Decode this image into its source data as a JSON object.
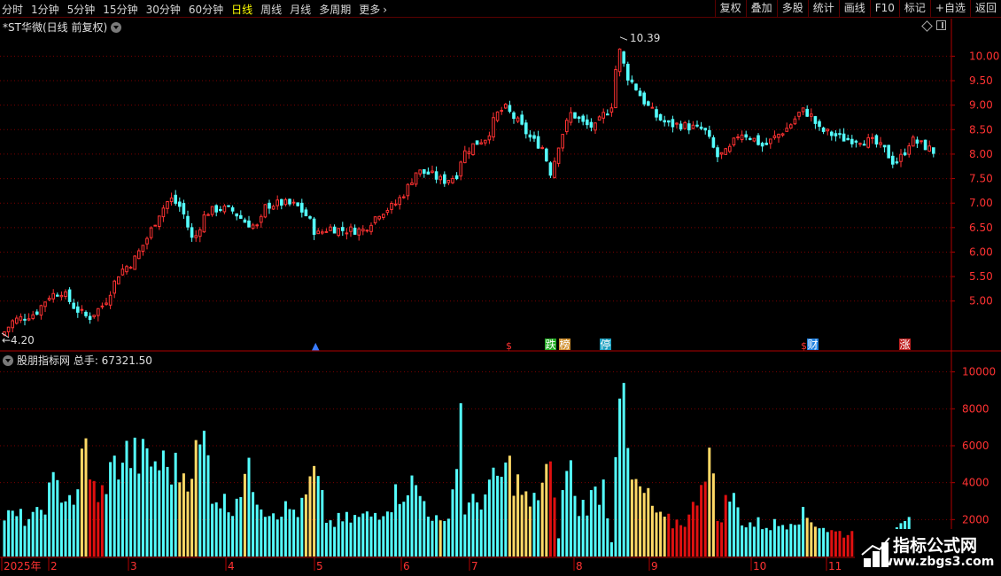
{
  "toolbar": {
    "periods": [
      {
        "label": "分时",
        "active": false
      },
      {
        "label": "1分钟",
        "active": false
      },
      {
        "label": "5分钟",
        "active": false
      },
      {
        "label": "15分钟",
        "active": false
      },
      {
        "label": "30分钟",
        "active": false
      },
      {
        "label": "60分钟",
        "active": false
      },
      {
        "label": "日线",
        "active": true
      },
      {
        "label": "周线",
        "active": false
      },
      {
        "label": "月线",
        "active": false
      },
      {
        "label": "多周期",
        "active": false
      }
    ],
    "more_label": "更多",
    "right_buttons": [
      "复权",
      "叠加",
      "多股",
      "统计",
      "画线",
      "F10",
      "标记",
      "+自选",
      "返回"
    ]
  },
  "main_chart": {
    "title": "*ST华微(日线 前复权)",
    "high_label": "10.39",
    "low_label": "4.20",
    "y_ticks": [
      "10.00",
      "9.50",
      "9.00",
      "8.50",
      "8.00",
      "7.50",
      "7.00",
      "6.50",
      "6.00",
      "5.50",
      "5.00"
    ],
    "markers": [
      {
        "label": "跌",
        "color": "#22aa22"
      },
      {
        "label": "榜",
        "color": "#d09030"
      },
      {
        "label": "停",
        "color": "#20a0c0"
      },
      {
        "label": "财",
        "color": "#2080e0"
      },
      {
        "label": "涨",
        "color": "#c02020"
      }
    ]
  },
  "volume_chart": {
    "title": "股朋指标网 总手: 67321.50",
    "y_ticks": [
      "10000",
      "8000",
      "6000",
      "4000",
      "2000"
    ]
  },
  "date_axis": {
    "labels": [
      "2025年",
      "2",
      "3",
      "4",
      "5",
      "6",
      "7",
      "8",
      "9",
      "10",
      "11"
    ]
  },
  "watermark": {
    "title": "指标公式网",
    "url": "www.zbgs3.com"
  },
  "colors": {
    "up": "#ff3232",
    "down": "#54ffff",
    "grid": "#7a0000",
    "axis": "#b00000",
    "vol_yellow": "#ffd966",
    "vol_red": "#e01010",
    "active_period": "#ffff00"
  },
  "chart_data": {
    "type": "candlestick",
    "title": "*ST华微(日线 前复权)",
    "y_range": [
      4.2,
      10.39
    ],
    "volume_range": [
      0,
      10500
    ],
    "price_path_anchors": [
      {
        "month": "2025-01",
        "close": 4.7
      },
      {
        "month": "2025-02",
        "close": 4.9
      },
      {
        "month": "2025-03",
        "close": 6.5
      },
      {
        "month": "2025-04",
        "close": 6.8
      },
      {
        "month": "2025-05",
        "close": 6.5
      },
      {
        "month": "2025-06",
        "close": 7.0
      },
      {
        "month": "2025-07",
        "close": 8.7
      },
      {
        "month": "2025-08",
        "close": 8.6
      },
      {
        "month": "2025-09",
        "close": 8.6
      },
      {
        "month": "2025-10",
        "close": 8.3
      },
      {
        "month": "2025-11",
        "close": 8.0
      }
    ],
    "high": 10.39,
    "low": 4.2,
    "total_volume": 67321.5
  }
}
